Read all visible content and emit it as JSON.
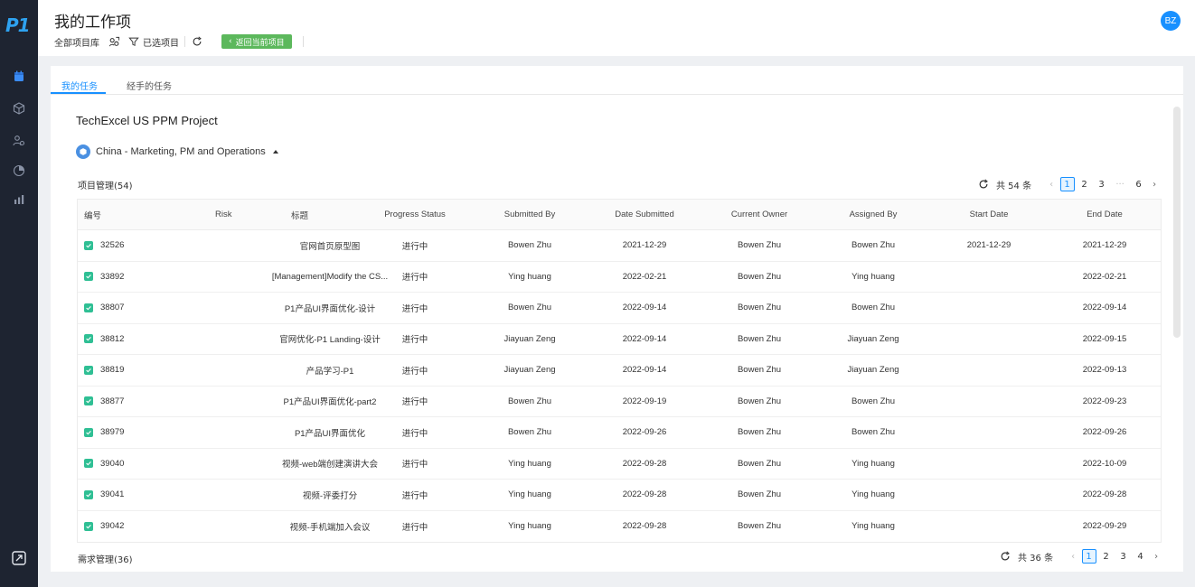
{
  "app": {
    "logo_text": "P1"
  },
  "header": {
    "title": "我的工作项",
    "all_projects_label": "全部项目库",
    "selected_label": "已选项目",
    "back_button_label": "返回当前项目",
    "avatar_initials": "BZ"
  },
  "tabs": [
    {
      "label": "我的任务",
      "active": true
    },
    {
      "label": "经手的任务",
      "active": false
    }
  ],
  "project": {
    "title": "TechExcel US PPM Project"
  },
  "group": {
    "label": "China - Marketing, PM and Operations"
  },
  "section1": {
    "label": "项目管理(54)",
    "total_label": "共 54 条",
    "pages": [
      "1",
      "2",
      "3",
      "6"
    ],
    "ellipsis": "···",
    "prev": "‹",
    "next": "›"
  },
  "section2": {
    "label": "需求管理(36)",
    "total_label": "共 36 条",
    "pages": [
      "1",
      "2",
      "3",
      "4"
    ],
    "prev": "‹",
    "next": "›"
  },
  "table": {
    "headers": [
      "编号",
      "Risk",
      "标题",
      "Progress Status",
      "Submitted By",
      "Date Submitted",
      "Current Owner",
      "Assigned By",
      "Start Date",
      "End Date"
    ],
    "rows": [
      {
        "id": "32526",
        "risk": "",
        "title": "官网首页原型图",
        "status": "进行中",
        "submitted_by": "Bowen Zhu",
        "date_submitted": "2021-12-29",
        "owner": "Bowen Zhu",
        "assigned_by": "Bowen Zhu",
        "start": "2021-12-29",
        "end": "2021-12-29"
      },
      {
        "id": "33892",
        "risk": "",
        "title": "[Management]Modify the CS...",
        "status": "进行中",
        "submitted_by": "Ying huang",
        "date_submitted": "2022-02-21",
        "owner": "Bowen Zhu",
        "assigned_by": "Ying huang",
        "start": "",
        "end": "2022-02-21"
      },
      {
        "id": "38807",
        "risk": "",
        "title": "P1产品UI界面优化-设计",
        "status": "进行中",
        "submitted_by": "Bowen Zhu",
        "date_submitted": "2022-09-14",
        "owner": "Bowen Zhu",
        "assigned_by": "Bowen Zhu",
        "start": "",
        "end": "2022-09-14"
      },
      {
        "id": "38812",
        "risk": "",
        "title": "官网优化-P1 Landing-设计",
        "status": "进行中",
        "submitted_by": "Jiayuan Zeng",
        "date_submitted": "2022-09-14",
        "owner": "Bowen Zhu",
        "assigned_by": "Jiayuan Zeng",
        "start": "",
        "end": "2022-09-15"
      },
      {
        "id": "38819",
        "risk": "",
        "title": "产品学习-P1",
        "status": "进行中",
        "submitted_by": "Jiayuan Zeng",
        "date_submitted": "2022-09-14",
        "owner": "Bowen Zhu",
        "assigned_by": "Jiayuan Zeng",
        "start": "",
        "end": "2022-09-13"
      },
      {
        "id": "38877",
        "risk": "",
        "title": "P1产品UI界面优化-part2",
        "status": "进行中",
        "submitted_by": "Bowen Zhu",
        "date_submitted": "2022-09-19",
        "owner": "Bowen Zhu",
        "assigned_by": "Bowen Zhu",
        "start": "",
        "end": "2022-09-23"
      },
      {
        "id": "38979",
        "risk": "",
        "title": "P1产品UI界面优化",
        "status": "进行中",
        "submitted_by": "Bowen Zhu",
        "date_submitted": "2022-09-26",
        "owner": "Bowen Zhu",
        "assigned_by": "Bowen Zhu",
        "start": "",
        "end": "2022-09-26"
      },
      {
        "id": "39040",
        "risk": "",
        "title": "视频-web端创建演讲大会",
        "status": "进行中",
        "submitted_by": "Ying huang",
        "date_submitted": "2022-09-28",
        "owner": "Bowen Zhu",
        "assigned_by": "Ying huang",
        "start": "",
        "end": "2022-10-09"
      },
      {
        "id": "39041",
        "risk": "",
        "title": "视频-评委打分",
        "status": "进行中",
        "submitted_by": "Ying huang",
        "date_submitted": "2022-09-28",
        "owner": "Bowen Zhu",
        "assigned_by": "Ying huang",
        "start": "",
        "end": "2022-09-28"
      },
      {
        "id": "39042",
        "risk": "",
        "title": "视频-手机端加入会议",
        "status": "进行中",
        "submitted_by": "Ying huang",
        "date_submitted": "2022-09-28",
        "owner": "Bowen Zhu",
        "assigned_by": "Ying huang",
        "start": "",
        "end": "2022-09-29"
      }
    ]
  },
  "colors": {
    "sidebar_bg": "#1e2431",
    "accent": "#1890ff",
    "back_button": "#5cb85c",
    "row_icon": "#2fbf94"
  },
  "icons": {
    "sidebar": [
      "calendar-icon",
      "cube-icon",
      "people-icon",
      "pie-chart-icon",
      "bar-chart-icon"
    ],
    "sidebar_bottom": "expand-icon"
  }
}
